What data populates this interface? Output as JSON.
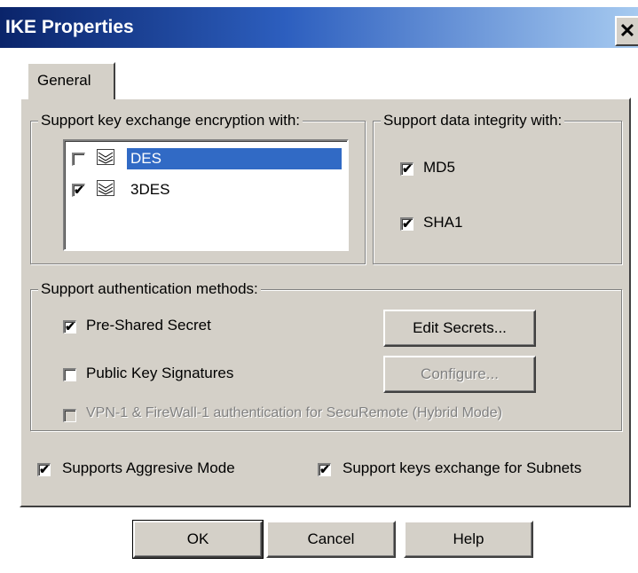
{
  "window": {
    "title": "IKE Properties",
    "close_icon": "close-icon"
  },
  "tabs": [
    {
      "label": "General",
      "active": true
    }
  ],
  "encryption": {
    "label": "Support key exchange encryption with:",
    "items": [
      {
        "label": "DES",
        "checked": false,
        "selected": true,
        "icon": "key-icon"
      },
      {
        "label": "3DES",
        "checked": true,
        "selected": false,
        "icon": "key-icon"
      }
    ]
  },
  "integrity": {
    "label": "Support data integrity with:",
    "items": [
      {
        "label": "MD5",
        "checked": true
      },
      {
        "label": "SHA1",
        "checked": true
      }
    ]
  },
  "authentication": {
    "label": "Support authentication methods:",
    "pre_shared": {
      "label": "Pre-Shared Secret",
      "checked": true
    },
    "public_key": {
      "label": "Public Key Signatures",
      "checked": false
    },
    "hybrid": {
      "label": "VPN-1 & FireWall-1 authentication for SecuRemote (Hybrid Mode)",
      "checked": false,
      "disabled": true
    },
    "edit_secrets_label": "Edit Secrets...",
    "configure_label": "Configure..."
  },
  "options": {
    "aggressive": {
      "label": "Supports Aggresive Mode",
      "checked": true
    },
    "subnets": {
      "label": "Support keys exchange for Subnets",
      "checked": true
    }
  },
  "buttons": {
    "ok": "OK",
    "cancel": "Cancel",
    "help": "Help"
  },
  "colors": {
    "selection": "#316ac5",
    "title_start": "#0a246a",
    "title_end": "#a6caf0",
    "face": "#d4d0c8"
  }
}
